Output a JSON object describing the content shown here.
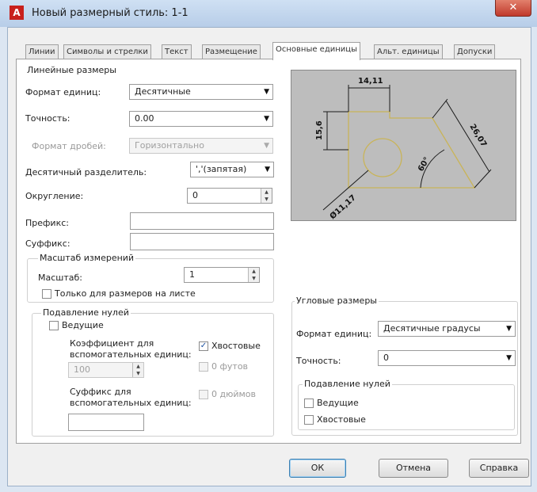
{
  "window": {
    "title": "Новый размерный стиль: 1-1",
    "app_icon_glyph": "A",
    "close_glyph": "✕"
  },
  "tabs": [
    {
      "label": "Линии"
    },
    {
      "label": "Символы и стрелки"
    },
    {
      "label": "Текст"
    },
    {
      "label": "Размещение"
    },
    {
      "label": "Основные единицы"
    },
    {
      "label": "Альт. единицы"
    },
    {
      "label": "Допуски"
    }
  ],
  "linear": {
    "group_title": "Линейные размеры",
    "unit_format_label": "Формат единиц:",
    "unit_format_value": "Десятичные",
    "precision_label": "Точность:",
    "precision_value": "0.00",
    "fraction_format_label": "Формат дробей:",
    "fraction_format_value": "Горизонтально",
    "decimal_separator_label": "Десятичный разделитель:",
    "decimal_separator_value": "','(запятая)",
    "round_off_label": "Округление:",
    "round_off_value": "0",
    "prefix_label": "Префикс:",
    "suffix_label": "Суффикс:"
  },
  "scale": {
    "group_title": "Масштаб измерений",
    "scale_label": "Масштаб:",
    "scale_value": "1",
    "layout_only_label": "Только для размеров на листе"
  },
  "zero_suppression": {
    "group_title": "Подавление нулей",
    "leading_label": "Ведущие",
    "sub_unit_factor_label_1": "Коэффициент для",
    "sub_unit_factor_label_2": "вспомогательных единиц:",
    "sub_unit_factor_value": "100",
    "sub_unit_suffix_label_1": "Суффикс для",
    "sub_unit_suffix_label_2": "вспомогательных единиц:",
    "trailing_label": "Хвостовые",
    "trailing_checked": true,
    "feet_label": "0 футов",
    "inches_label": "0 дюймов",
    "check_glyph": "✓"
  },
  "preview": {
    "dim_top": "14,11",
    "dim_left": "15,6",
    "dim_right": "26,07",
    "dim_angle": "60°",
    "dim_diameter": "Ø11,17",
    "line_color": "#c9b458",
    "arrow_color": "#1a1a1a"
  },
  "angular": {
    "group_title": "Угловые размеры",
    "unit_format_label": "Формат единиц:",
    "unit_format_value": "Десятичные градусы",
    "precision_label": "Точность:",
    "precision_value": "0",
    "zero_suppression_title": "Подавление нулей",
    "leading_label": "Ведущие",
    "trailing_label": "Хвостовые"
  },
  "buttons": {
    "ok": "ОК",
    "cancel": "Отмена",
    "help": "Справка"
  },
  "icons": {
    "dropdown_arrow": "▼",
    "spin_up": "▲",
    "spin_down": "▼"
  }
}
